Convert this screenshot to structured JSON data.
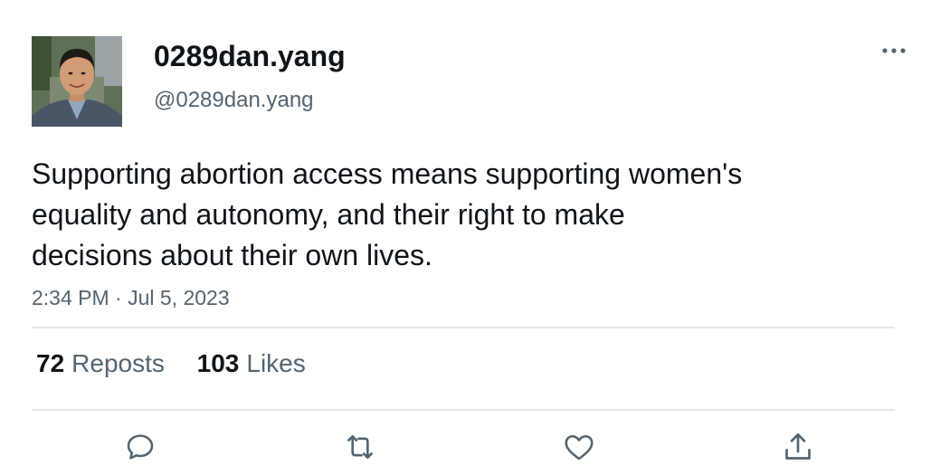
{
  "author": {
    "display_name": "0289dan.yang",
    "handle": "@0289dan.yang",
    "avatar": "profile-photo"
  },
  "tweet": {
    "lines": [
      "Supporting abortion access means supporting women's",
      "equality and autonomy, and their right to make",
      "decisions about their own lives."
    ],
    "timestamp": "2:34 PM · Jul 5, 2023"
  },
  "stats": {
    "reposts_count": "72",
    "reposts_label": "Reposts",
    "likes_count": "103",
    "likes_label": "Likes"
  },
  "actions": {
    "reply_icon": "comment-icon",
    "retweet_icon": "retweet-icon",
    "like_icon": "heart-icon",
    "share_icon": "share-icon",
    "more_icon": "more-horizontal-icon"
  },
  "colors": {
    "text_primary": "#0f1419",
    "text_secondary": "#536471",
    "divider": "#e3e6e8",
    "icon": "#536471"
  }
}
